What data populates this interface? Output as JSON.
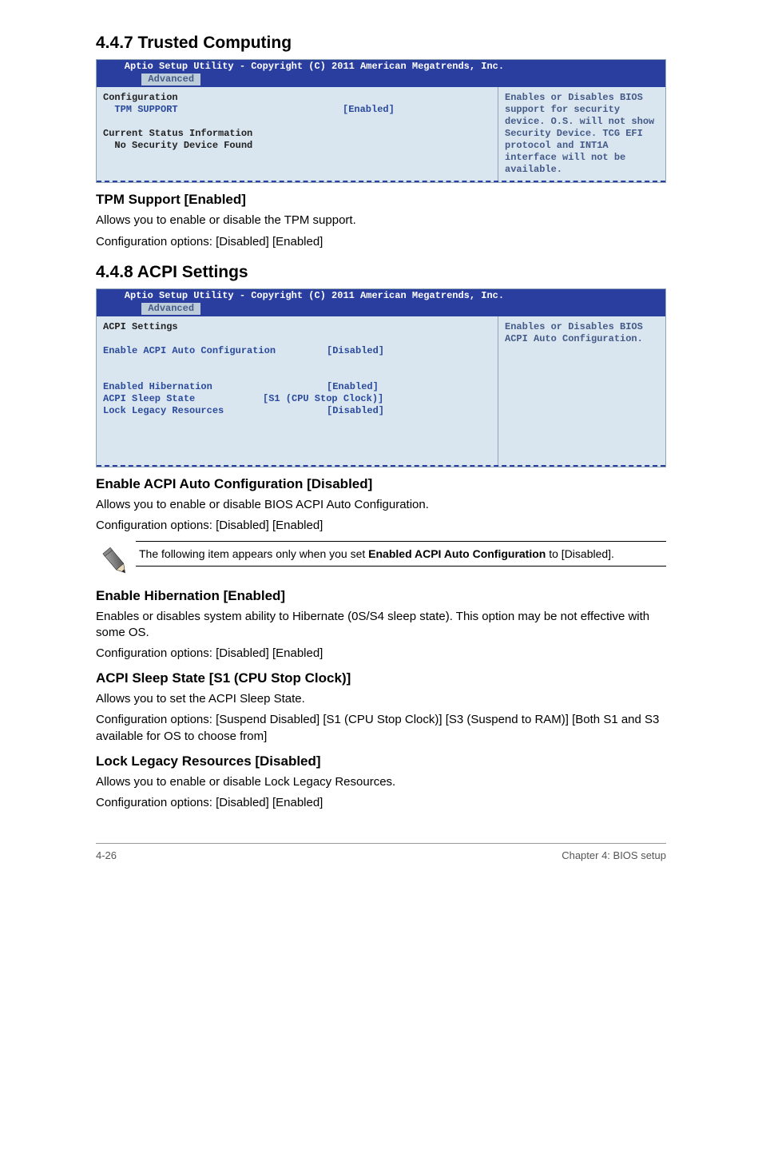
{
  "section_447": {
    "title": "4.4.7     Trusted Computing",
    "bios": {
      "title_line": "    Aptio Setup Utility - Copyright (C) 2011 American Megatrends, Inc.",
      "tab": "Advanced",
      "left_label_config": "Configuration",
      "left_tpm_label": "  TPM SUPPORT",
      "left_tpm_value": "[Enabled]",
      "left_status_1": "Current Status Information",
      "left_status_2": "  No Security Device Found",
      "right": "Enables or Disables BIOS support for security device. O.S. will not show Security Device. TCG EFI protocol and INT1A interface will not be available."
    },
    "sub1_title": "TPM Support [Enabled]",
    "sub1_p1": "Allows you to enable or disable the TPM support.",
    "sub1_p2": "Configuration options: [Disabled] [Enabled]"
  },
  "section_448": {
    "title": "4.4.8     ACPI Settings",
    "bios": {
      "title_line": "    Aptio Setup Utility - Copyright (C) 2011 American Megatrends, Inc.",
      "tab": "Advanced",
      "left_heading": "ACPI Settings",
      "row1_label": "Enable ACPI Auto Configuration",
      "row1_value": "[Disabled]",
      "row2_label": "Enabled Hibernation",
      "row2_value": "[Enabled]",
      "row3_label": "ACPI Sleep State",
      "row3_value": "[S1 (CPU Stop Clock)]",
      "row4_label": "Lock Legacy Resources",
      "row4_value": "[Disabled]",
      "right": "Enables or Disables BIOS ACPI Auto Configuration."
    },
    "sub1_title": "Enable ACPI Auto Configuration [Disabled]",
    "sub1_p1": "Allows you to enable or disable BIOS ACPI Auto Configuration.",
    "sub1_p2": "Configuration options: [Disabled] [Enabled]",
    "note_pre": "The following item appears only when you set ",
    "note_bold": "Enabled ACPI Auto Configuration",
    "note_post": " to [Disabled].",
    "sub2_title": "Enable Hibernation [Enabled]",
    "sub2_p1": "Enables or disables system ability to Hibernate (0S/S4 sleep state). This option may be not effective with some OS.",
    "sub2_p2": "Configuration options: [Disabled] [Enabled]",
    "sub3_title": "ACPI Sleep State [S1 (CPU Stop Clock)]",
    "sub3_p1": "Allows you to set the ACPI Sleep State.",
    "sub3_p2": "Configuration options: [Suspend Disabled] [S1 (CPU Stop Clock)] [S3 (Suspend to RAM)] [Both S1 and S3 available for OS to choose from]",
    "sub4_title": "Lock Legacy Resources [Disabled]",
    "sub4_p1": "Allows you to enable or disable Lock Legacy Resources.",
    "sub4_p2": "Configuration options: [Disabled] [Enabled]"
  },
  "footer": {
    "left": "4-26",
    "right": "Chapter 4: BIOS setup"
  }
}
